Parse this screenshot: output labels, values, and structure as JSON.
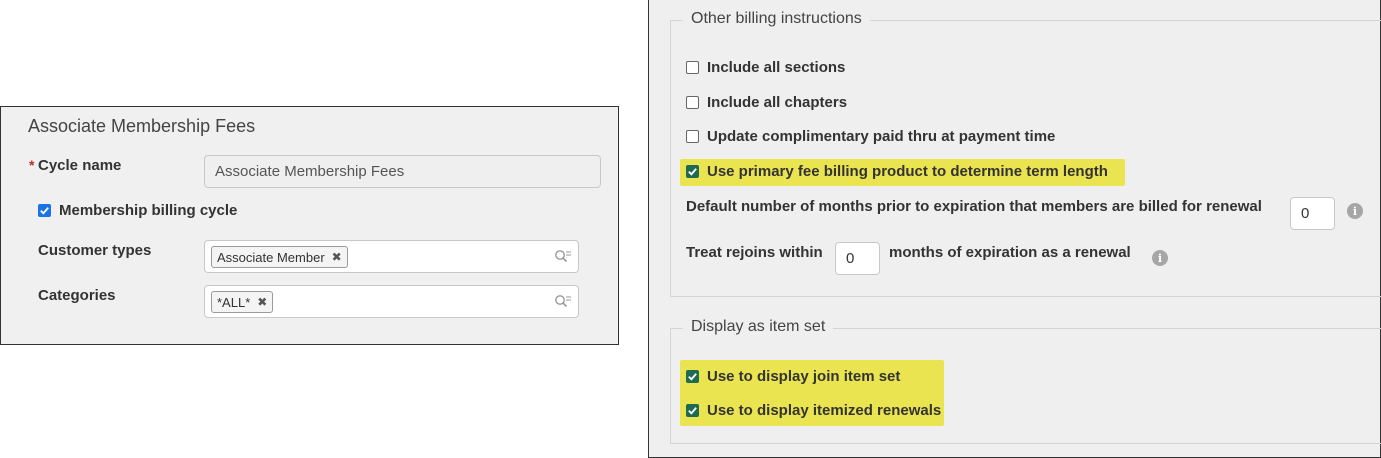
{
  "membership_form": {
    "title": "Associate Membership Fees",
    "required_marker": "*",
    "cycle_name_label": "Cycle name",
    "cycle_name_value": "Associate Membership Fees",
    "membership_billing_cycle_label": "Membership billing cycle",
    "membership_billing_cycle_checked": true,
    "customer_types_label": "Customer types",
    "customer_types_tags": [
      "Associate Member"
    ],
    "categories_label": "Categories",
    "categories_tags": [
      "*ALL*"
    ],
    "tag_remove_glyph": "✖"
  },
  "billing_instructions": {
    "legend": "Other billing instructions",
    "options": [
      {
        "label": "Include all sections",
        "checked": false
      },
      {
        "label": "Include all chapters",
        "checked": false
      },
      {
        "label": "Update complimentary paid thru at payment time",
        "checked": false
      },
      {
        "label": "Use primary fee billing product to determine term length",
        "checked": true
      }
    ],
    "default_months_label": "Default number of months prior to expiration that members are billed for renewal",
    "default_months_value": "0",
    "rejoin_prefix": "Treat rejoins within",
    "rejoin_value": "0",
    "rejoin_suffix": "months of expiration as a renewal",
    "info_glyph": "i"
  },
  "display_item_set": {
    "legend": "Display as item set",
    "options": [
      {
        "label": "Use to display join item set",
        "checked": true
      },
      {
        "label": "Use to display itemized renewals",
        "checked": true
      }
    ]
  },
  "colors": {
    "highlight": "#ebe451",
    "checkbox_blue": "#1a73e8",
    "checkbox_green": "#1f6b4f",
    "required": "#c62828"
  },
  "icons": {
    "lookup": "search-lookup-icon",
    "info": "info-icon",
    "check": "checkmark-icon",
    "remove": "close-icon"
  }
}
